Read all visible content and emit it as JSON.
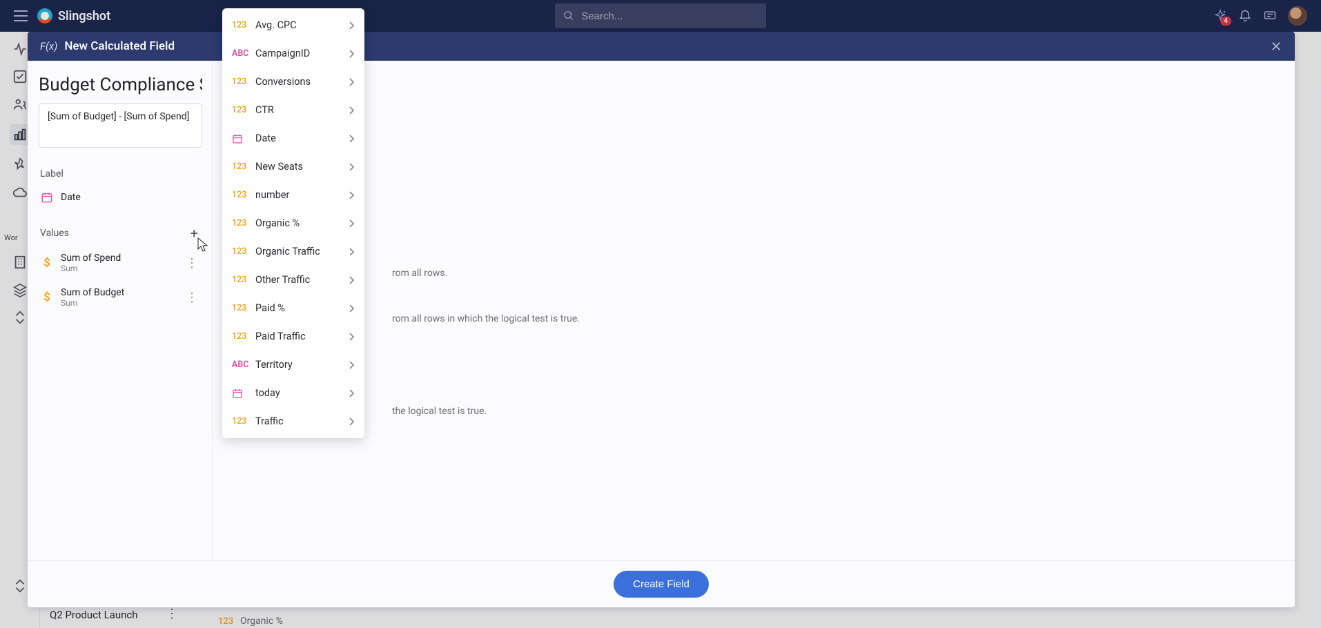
{
  "app": {
    "name": "Slingshot"
  },
  "search": {
    "placeholder": "Search..."
  },
  "nav": {
    "badge": "4"
  },
  "leftRail": {
    "wor_label": "Wor"
  },
  "bg": {
    "project": "Q2 Product Launch",
    "partial_field": "Organic %"
  },
  "modal": {
    "fx": "F(x)",
    "title": "New Calculated Field",
    "report_title": "Budget Compliance Sum",
    "formula": "[Sum of Budget] - [Sum of Spend]",
    "label_section": "Label",
    "values_section": "Values",
    "label_field": {
      "name": "Date"
    },
    "values": [
      {
        "name": "Sum of Spend",
        "agg": "Sum"
      },
      {
        "name": "Sum of Budget",
        "agg": "Sum"
      }
    ],
    "hints": {
      "h1": "rom all rows.",
      "h2": "rom all rows in which the logical test is true.",
      "h3": "the logical test is true."
    },
    "create_btn": "Create Field"
  },
  "popover": {
    "items": [
      {
        "type": "123",
        "label": "Avg. CPC"
      },
      {
        "type": "abc",
        "label": "CampaignID"
      },
      {
        "type": "123",
        "label": "Conversions"
      },
      {
        "type": "123",
        "label": "CTR"
      },
      {
        "type": "date",
        "label": "Date"
      },
      {
        "type": "123",
        "label": "New Seats"
      },
      {
        "type": "123",
        "label": "number"
      },
      {
        "type": "123",
        "label": "Organic %"
      },
      {
        "type": "123",
        "label": "Organic Traffic"
      },
      {
        "type": "123",
        "label": "Other Traffic"
      },
      {
        "type": "123",
        "label": "Paid %"
      },
      {
        "type": "123",
        "label": "Paid Traffic"
      },
      {
        "type": "abc",
        "label": "Territory"
      },
      {
        "type": "date",
        "label": "today"
      },
      {
        "type": "123",
        "label": "Traffic"
      }
    ]
  }
}
